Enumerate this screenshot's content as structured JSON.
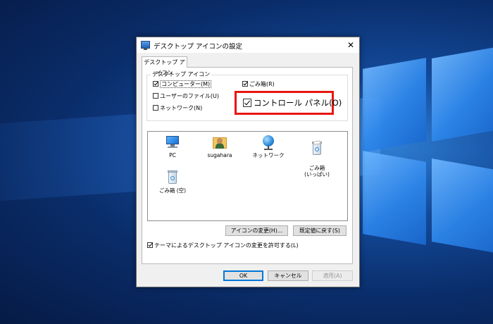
{
  "dialog": {
    "title": "デスクトップ アイコンの設定",
    "close_glyph": "✕",
    "tab_label": "デスクトップ アイコン",
    "group_title": "デスクトップ アイコン",
    "checkboxes": [
      {
        "label": "コンピューター(M)",
        "checked": true
      },
      {
        "label": "ユーザーのファイル(U)",
        "checked": false
      },
      {
        "label": "ネットワーク(N)",
        "checked": false
      },
      {
        "label": "ごみ箱(R)",
        "checked": true
      },
      {
        "label": "コントロール パネル(O)",
        "checked": true
      }
    ],
    "icons": [
      {
        "label": "PC",
        "icon": "pc-icon"
      },
      {
        "label": "sugahara",
        "icon": "user-folder-icon"
      },
      {
        "label": "ネットワーク",
        "icon": "network-icon"
      },
      {
        "label": "ごみ箱\n(いっぱい)",
        "icon": "recycle-bin-full-icon"
      },
      {
        "label": "ごみ箱 (空)",
        "icon": "recycle-bin-empty-icon"
      }
    ],
    "change_icon_label": "アイコンの変更(H)...",
    "restore_default_label": "既定値に戻す(S)",
    "theme_checkbox": {
      "label": "テーマによるデスクトップ アイコンの変更を許可する(L)",
      "checked": true
    },
    "ok_label": "OK",
    "cancel_label": "キャンセル",
    "apply_label": "適用(A)"
  },
  "colors": {
    "highlight_border": "#e8170f",
    "accent": "#0078d7"
  }
}
